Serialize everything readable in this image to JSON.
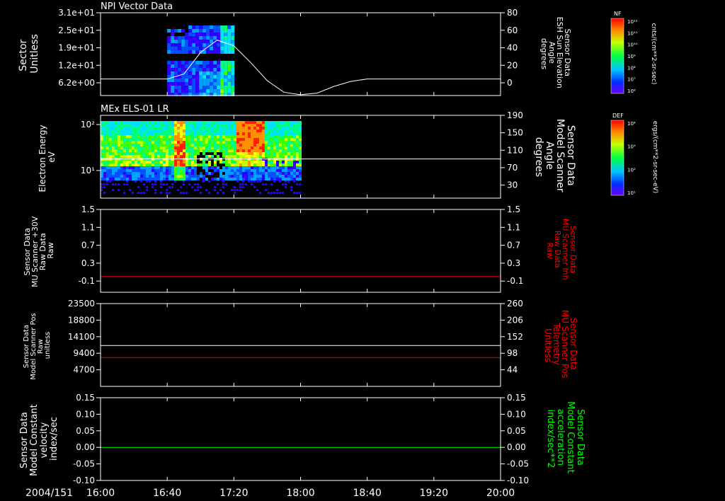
{
  "date_label": "2004/151",
  "time_ticks": [
    "16:00",
    "16:40",
    "17:20",
    "18:00",
    "18:40",
    "19:20",
    "20:00"
  ],
  "colors": {
    "white": "#ffffff",
    "red": "#ff0000",
    "green": "#00ff00",
    "background": "#000000"
  },
  "colorbars": [
    {
      "id": "nf",
      "tag": "NF",
      "unit": "cnts/(cm**2-sr-sec)",
      "tick_labels": [
        "10¹²",
        "10¹¹",
        "10¹⁰",
        "10⁹",
        "10⁸",
        "10⁷",
        "10⁶"
      ]
    },
    {
      "id": "def",
      "tag": "DEF",
      "unit": "ergs/(cm**2-sr-sec-eV)",
      "tick_labels": [
        "10⁴",
        "10³",
        "10²",
        "10¹"
      ]
    }
  ],
  "chart_data": [
    {
      "id": "npi",
      "type": "heatmap",
      "title": "NPI Vector Data",
      "ylabel_left": [
        "Sector",
        "Unitless"
      ],
      "yticks_left": [
        "3.1e+01",
        "2.5e+01",
        "1.9e+01",
        "1.2e+01",
        "6.2e+00"
      ],
      "ylabel_right": [
        "Sensor Data",
        "ESH Sun Elevation",
        "Angle",
        "degrees"
      ],
      "yticks_right": [
        "80",
        "60",
        "40",
        "20",
        "0"
      ],
      "ylim_right": [
        -20,
        80
      ],
      "spectrogram": {
        "time_start": "16:40",
        "time_end": "17:20"
      },
      "lines": [
        {
          "color": "white",
          "axis": "right",
          "x": [
            "16:00",
            "16:40",
            "16:50",
            "17:00",
            "17:10",
            "17:20",
            "17:30",
            "17:40",
            "17:50",
            "18:00",
            "18:10",
            "18:20",
            "18:30",
            "18:40",
            "19:00",
            "20:00"
          ],
          "y": [
            0,
            0,
            6,
            32,
            47,
            40,
            20,
            -2,
            -16,
            -19,
            -17,
            -9,
            -3,
            0,
            0,
            0
          ]
        }
      ]
    },
    {
      "id": "els",
      "type": "heatmap",
      "title": "MEx ELS-01 LR",
      "ylabel_left": [
        "Electron Energy",
        "eV"
      ],
      "yticks_left": [
        "10²",
        "10¹"
      ],
      "ylim_left_log": [
        0.4,
        2.2
      ],
      "ylabel_right": [
        "Sensor Data",
        "Model Scanner",
        "Angle",
        "degrees"
      ],
      "yticks_right": [
        "190",
        "150",
        "110",
        "70",
        "30"
      ],
      "ylim_right": [
        0,
        190
      ],
      "spectrogram": {
        "time_start": "16:00",
        "time_end": "18:00"
      },
      "lines": [
        {
          "color": "white",
          "axis": "right",
          "x": [
            "16:00",
            "20:00"
          ],
          "y": [
            90,
            90
          ]
        }
      ]
    },
    {
      "id": "mu_raw",
      "type": "line",
      "ylabel_left": [
        "Sensor Data",
        "MU Scanner +30V",
        "Raw Data",
        "Raw"
      ],
      "yticks_left": [
        "1.5",
        "1.1",
        "0.7",
        "0.3",
        "-0.1"
      ],
      "ylim_left": [
        -0.35,
        1.5
      ],
      "ylabel_right": [
        "Sensor Data",
        "MU Scanner Inh",
        "Raw Data",
        "Raw"
      ],
      "ylabel_right_color": "red",
      "yticks_right": [
        "1.5",
        "1.1",
        "0.7",
        "0.3",
        "-0.1"
      ],
      "ylim_right": [
        -0.35,
        1.5
      ],
      "lines": [
        {
          "color": "red",
          "axis": "left",
          "x": [
            "16:00",
            "20:00"
          ],
          "y": [
            0.0,
            0.0
          ]
        }
      ]
    },
    {
      "id": "scanner_pos",
      "type": "line",
      "ylabel_left": [
        "Sensor Data",
        "Model Scanner Pos",
        "Raw",
        "unitless"
      ],
      "yticks_left": [
        "23500",
        "18800",
        "14100",
        "9400",
        "4700"
      ],
      "ylim_left": [
        0,
        23500
      ],
      "ylabel_right": [
        "Sensor Data",
        "MU Scanner Pos",
        "Telemetry",
        "Unitless"
      ],
      "ylabel_right_color": "red",
      "yticks_right": [
        "260",
        "206",
        "152",
        "98",
        "44"
      ],
      "ylim_right": [
        -10,
        260
      ],
      "lines": [
        {
          "color": "white",
          "axis": "left",
          "x": [
            "16:00",
            "20:00"
          ],
          "y": [
            11600,
            11600
          ]
        },
        {
          "color": "red",
          "axis": "right",
          "x": [
            "16:00",
            "20:00"
          ],
          "y": [
            84,
            84
          ]
        }
      ]
    },
    {
      "id": "model_const",
      "type": "line",
      "ylabel_left": [
        "Sensor Data",
        "Model Constant",
        "velocity",
        "index/sec"
      ],
      "yticks_left": [
        "0.15",
        "0.10",
        "0.05",
        "0.00",
        "-0.05",
        "-0.10"
      ],
      "ylim_left": [
        -0.1,
        0.15
      ],
      "ylabel_right": [
        "Sensor Data",
        "Model Constant",
        "acceleration",
        "index/sec**2"
      ],
      "ylabel_right_color": "green",
      "yticks_right": [
        "0.15",
        "0.10",
        "0.05",
        "0.00",
        "-0.05",
        "-0.10"
      ],
      "ylim_right": [
        -0.1,
        0.15
      ],
      "lines": [
        {
          "color": "green",
          "axis": "left",
          "x": [
            "16:00",
            "20:00"
          ],
          "y": [
            0.0,
            0.0
          ]
        }
      ]
    }
  ]
}
